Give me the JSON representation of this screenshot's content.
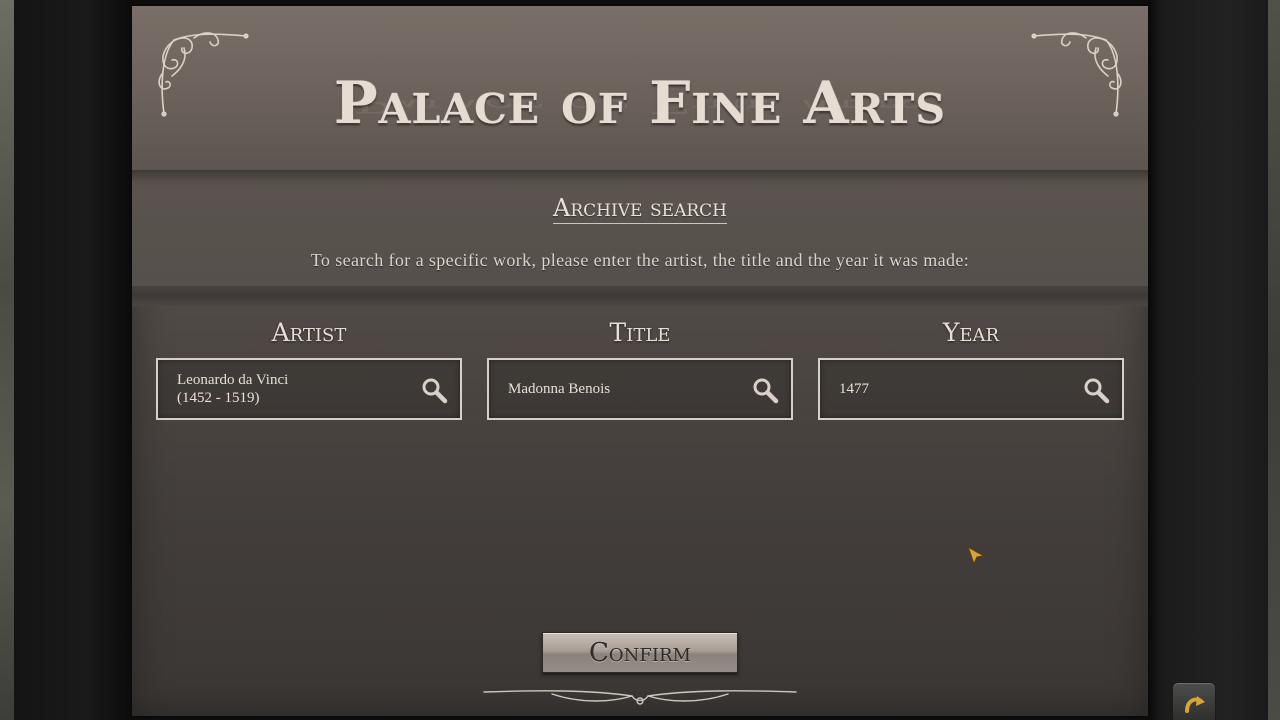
{
  "page": {
    "title": "Palace of Fine Arts",
    "subtitle": "Archive search",
    "instructions": "To search for a specific work, please enter the artist, the title and the year it was made:"
  },
  "fields": [
    {
      "label": "Artist",
      "value": "Leonardo da Vinci\n(1452 - 1519)",
      "icon": "search-icon"
    },
    {
      "label": "Title",
      "value": "Madonna Benois",
      "icon": "search-icon"
    },
    {
      "label": "Year",
      "value": "1477",
      "icon": "search-icon"
    }
  ],
  "confirm_label": "Confirm",
  "icons": {
    "corner_ornament": "ornament-icon",
    "cursor": "arrow-cursor-icon",
    "corner_button": "undo-arrow-icon"
  },
  "colors": {
    "panel_top": "#7a6f68",
    "panel_bottom": "#3b3735",
    "text_light": "#e6dcd2",
    "field_border": "#d8d0c6",
    "button_face": "#a99f97",
    "cursor_gold": "#d6a43a"
  }
}
